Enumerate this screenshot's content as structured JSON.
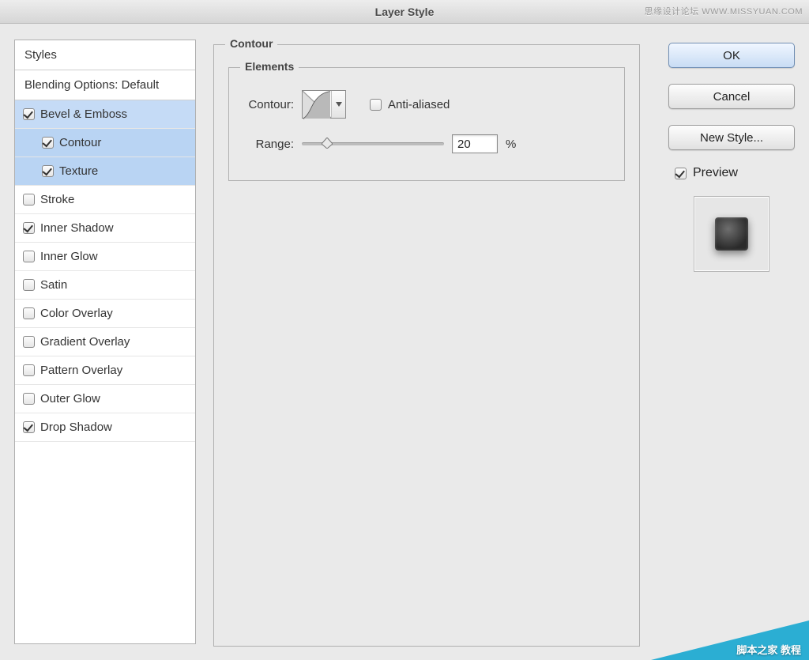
{
  "window": {
    "title": "Layer Style"
  },
  "watermark_top": "思缘设计论坛  WWW.MISSYUAN.COM",
  "sidebar": {
    "styles_header": "Styles",
    "blend_header": "Blending Options: Default",
    "items": [
      {
        "label": "Bevel & Emboss",
        "checked": true,
        "selected": true,
        "child": false
      },
      {
        "label": "Contour",
        "checked": true,
        "selected": true,
        "child": true
      },
      {
        "label": "Texture",
        "checked": true,
        "selected": true,
        "child": true
      },
      {
        "label": "Stroke",
        "checked": false,
        "selected": false,
        "child": false
      },
      {
        "label": "Inner Shadow",
        "checked": true,
        "selected": false,
        "child": false
      },
      {
        "label": "Inner Glow",
        "checked": false,
        "selected": false,
        "child": false
      },
      {
        "label": "Satin",
        "checked": false,
        "selected": false,
        "child": false
      },
      {
        "label": "Color Overlay",
        "checked": false,
        "selected": false,
        "child": false
      },
      {
        "label": "Gradient Overlay",
        "checked": false,
        "selected": false,
        "child": false
      },
      {
        "label": "Pattern Overlay",
        "checked": false,
        "selected": false,
        "child": false
      },
      {
        "label": "Outer Glow",
        "checked": false,
        "selected": false,
        "child": false
      },
      {
        "label": "Drop Shadow",
        "checked": true,
        "selected": false,
        "child": false
      }
    ]
  },
  "panel": {
    "group_title": "Contour",
    "elements_title": "Elements",
    "contour_label": "Contour:",
    "anti_aliased_label": "Anti-aliased",
    "anti_aliased_checked": false,
    "range_label": "Range:",
    "range_value": "20",
    "range_unit": "%"
  },
  "actions": {
    "ok": "OK",
    "cancel": "Cancel",
    "new_style": "New Style...",
    "preview_label": "Preview",
    "preview_checked": true
  },
  "watermark_br": "脚本之家 教程"
}
